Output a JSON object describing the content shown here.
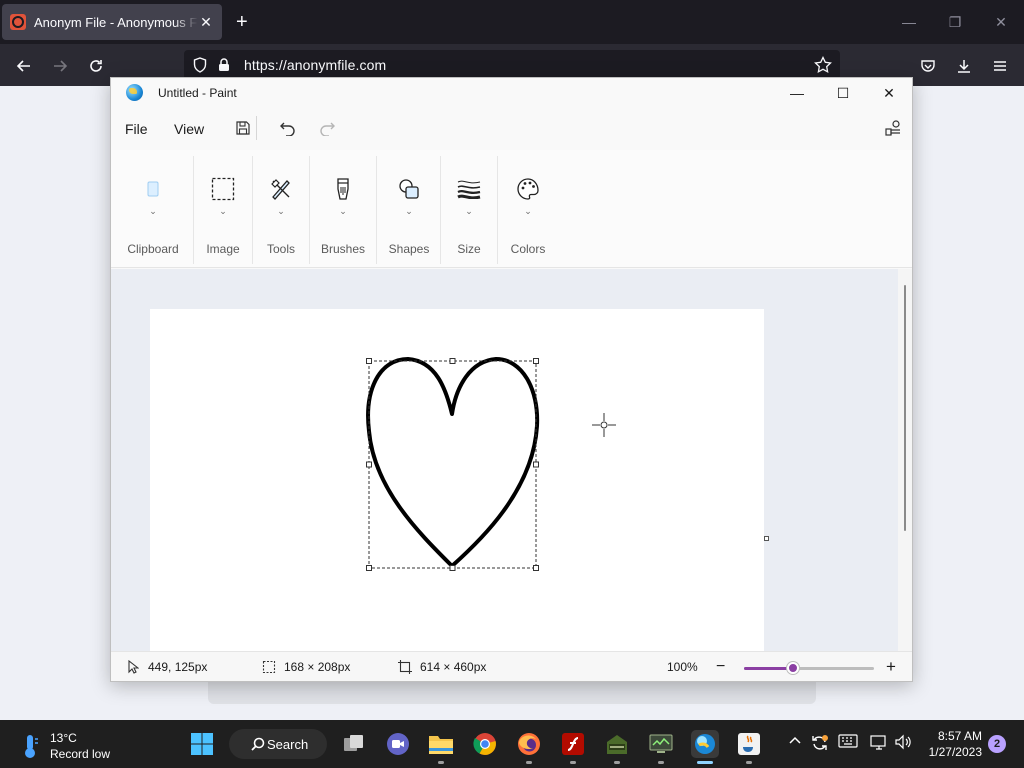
{
  "browser": {
    "tab": {
      "title": "Anonym File - Anonymous File",
      "close": "✕"
    },
    "new_tab": "+",
    "url": "https://anonymfile.com",
    "window_controls": {
      "minimize": "—",
      "restore": "❐",
      "close": "✕"
    }
  },
  "paint": {
    "title": "Untitled - Paint",
    "window_controls": {
      "minimize": "—",
      "maximize": "☐",
      "close": "✕"
    },
    "menu": {
      "file": "File",
      "view": "View"
    },
    "ribbon": {
      "groups": [
        {
          "label": "Clipboard",
          "icon": "clipboard-icon"
        },
        {
          "label": "Image",
          "icon": "selection-icon"
        },
        {
          "label": "Tools",
          "icon": "tools-icon"
        },
        {
          "label": "Brushes",
          "icon": "brush-icon"
        },
        {
          "label": "Shapes",
          "icon": "shapes-icon"
        },
        {
          "label": "Size",
          "icon": "size-icon"
        },
        {
          "label": "Colors",
          "icon": "palette-icon"
        }
      ]
    },
    "status": {
      "cursor_pos": "449, 125px",
      "selection_size": "168 × 208px",
      "canvas_size": "614 × 460px",
      "zoom": "100%",
      "zoom_slider_fraction": 0.38
    },
    "colors": {
      "accent": "#8b3fa3",
      "stroke": "#000000"
    }
  },
  "taskbar": {
    "weather": {
      "temp": "13°C",
      "desc": "Record low"
    },
    "search_label": "Search",
    "clock": {
      "time": "8:57 AM",
      "date": "1/27/2023"
    },
    "notifications": "2"
  }
}
